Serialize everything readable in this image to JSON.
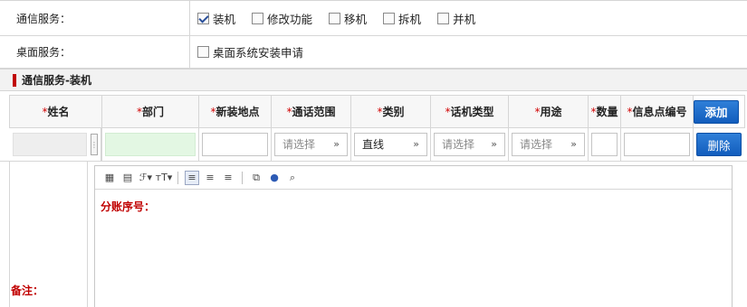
{
  "comm_service": {
    "label": "通信服务：",
    "options": [
      {
        "label": "装机",
        "checked": true
      },
      {
        "label": "修改功能",
        "checked": false
      },
      {
        "label": "移机",
        "checked": false
      },
      {
        "label": "拆机",
        "checked": false
      },
      {
        "label": "并机",
        "checked": false
      }
    ]
  },
  "desktop_service": {
    "label": "桌面服务：",
    "options": [
      {
        "label": "桌面系统安装申请",
        "checked": false
      }
    ]
  },
  "section": {
    "title": "通信服务-装机"
  },
  "table": {
    "required_mark": "*",
    "headers": [
      "姓名",
      "部门",
      "新装地点",
      "通话范围",
      "类别",
      "话机类型",
      "用途",
      "数量",
      "信息点编号"
    ],
    "add_label": "添加",
    "delete_label": "删除",
    "row": {
      "name": "",
      "department": "",
      "location": "",
      "call_range": "请选择",
      "category": "直线",
      "phone_type": "请选择",
      "purpose": "请选择",
      "quantity": "",
      "info_point": ""
    }
  },
  "remark": {
    "label": "备注：",
    "editor_text": "分账序号："
  },
  "icons": {
    "chevron": "chevron-down-icon"
  }
}
